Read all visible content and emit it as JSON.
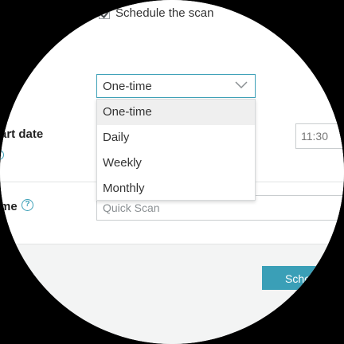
{
  "schedule": {
    "checkbox_label": "Schedule the scan",
    "checked": true
  },
  "frequency": {
    "selected": "One-time",
    "options": [
      "One-time",
      "Daily",
      "Weekly",
      "Monthly"
    ]
  },
  "start_date": {
    "label": "art date",
    "time_value": "11:30"
  },
  "scan_name": {
    "label": "me",
    "help_glyph": "?",
    "placeholder": "Quick Scan"
  },
  "footer": {
    "primary_label": "Sche"
  },
  "colors": {
    "accent": "#3a9fb7",
    "border": "#c9cdcf",
    "footer_bg": "#f3f4f4"
  },
  "icons": {
    "check": "checkmark-icon",
    "chevron": "chevron-down-icon",
    "help": "help-circle-icon"
  }
}
